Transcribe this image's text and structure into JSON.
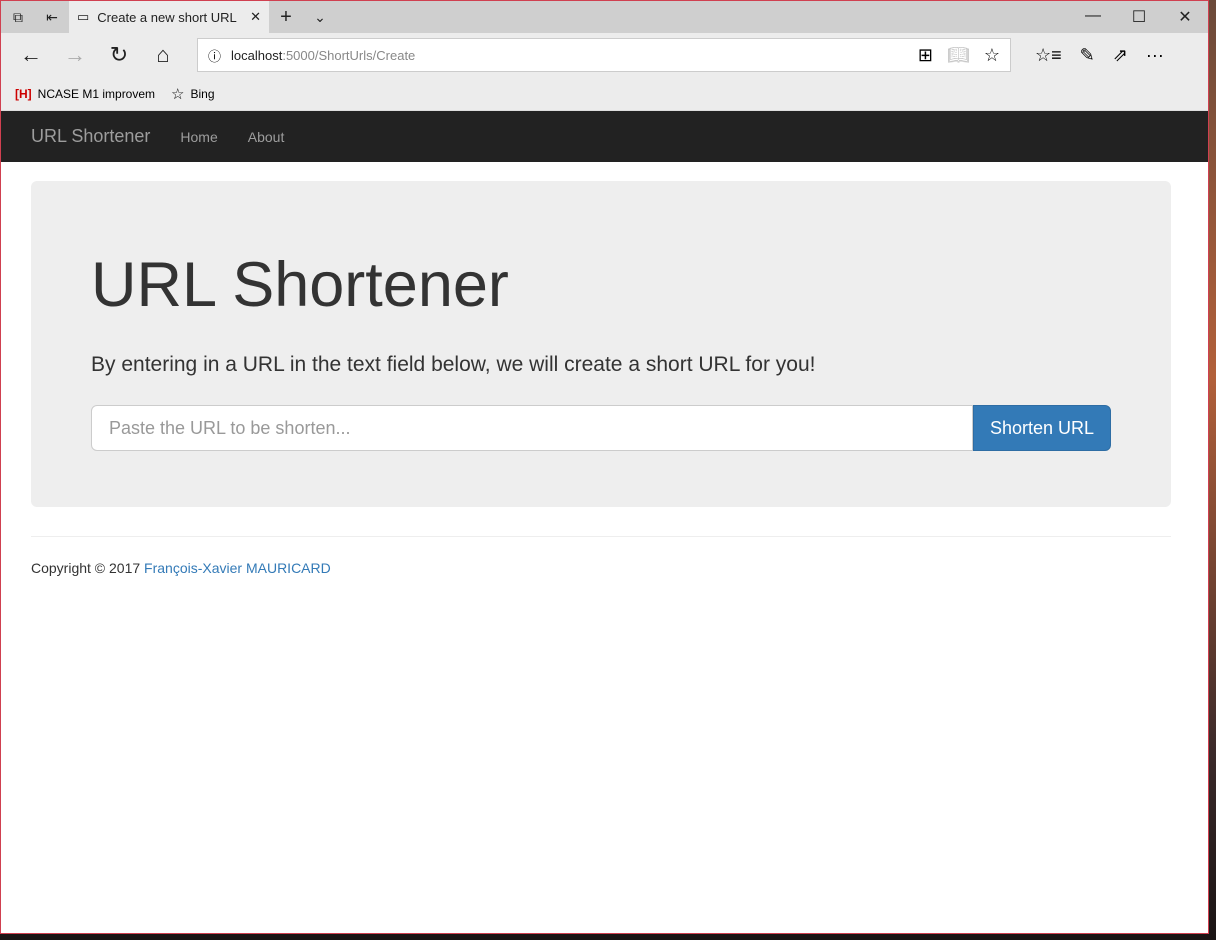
{
  "browser": {
    "tab_title": "Create a new short URL",
    "url_host": "localhost",
    "url_rest": ":5000/ShortUrls/Create",
    "favorites": [
      {
        "badge": "[H]",
        "label": "NCASE M1 improvem"
      },
      {
        "label": "Bing"
      }
    ]
  },
  "navbar": {
    "brand": "URL Shortener",
    "links": [
      "Home",
      "About"
    ]
  },
  "jumbotron": {
    "title": "URL Shortener",
    "lead": "By entering in a URL in the text field below, we will create a short URL for you!",
    "input_placeholder": "Paste the URL to be shorten...",
    "input_value": "",
    "button": "Shorten URL"
  },
  "footer": {
    "text": "Copyright © 2017 ",
    "author": "François-Xavier MAURICARD"
  },
  "colors": {
    "primary": "#337ab7",
    "navbar": "#222222",
    "jumbotron": "#eeeeee"
  }
}
